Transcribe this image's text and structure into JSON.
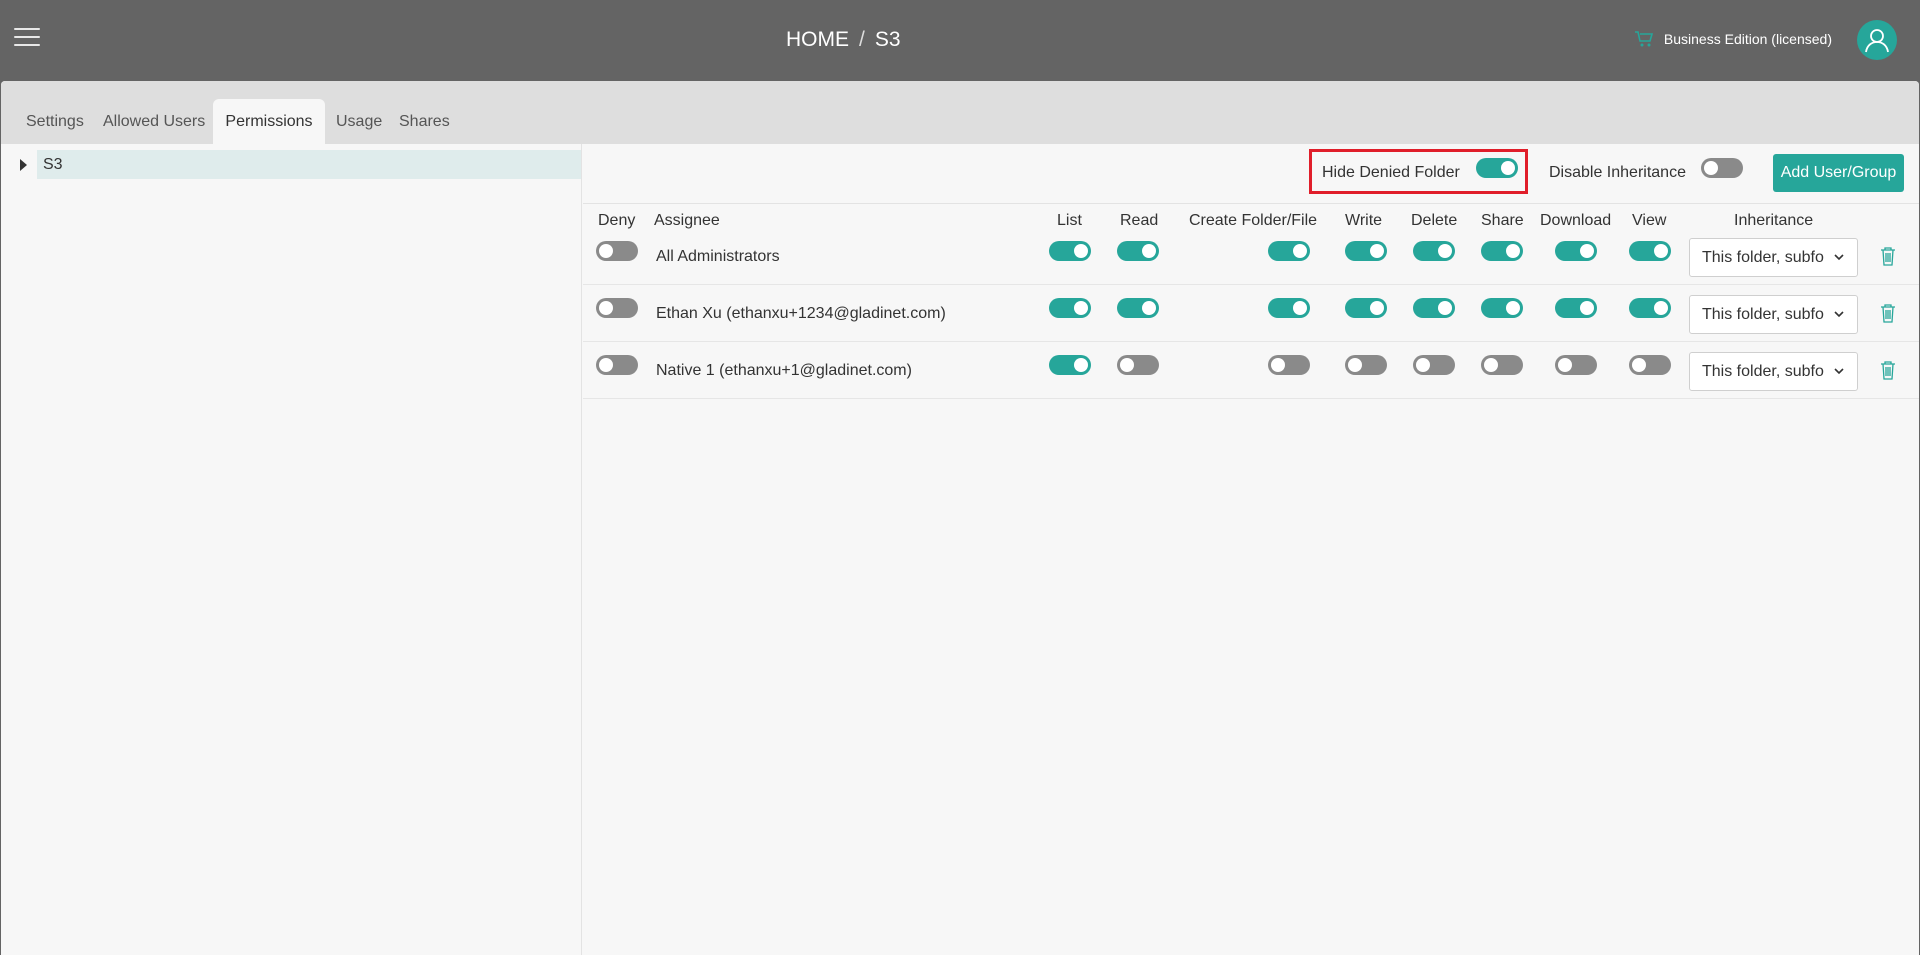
{
  "header": {
    "breadcrumb": [
      "HOME",
      "S3"
    ],
    "breadcrumb_sep": "/",
    "edition_label": "Business Edition (licensed)"
  },
  "tabs": [
    {
      "label": "Settings"
    },
    {
      "label": "Allowed Users"
    },
    {
      "label": "Permissions"
    },
    {
      "label": "Usage"
    },
    {
      "label": "Shares"
    }
  ],
  "active_tab": "Permissions",
  "tree": {
    "root_label": "S3"
  },
  "toolbar": {
    "hide_denied_label": "Hide Denied Folder",
    "hide_denied_on": true,
    "disable_inheritance_label": "Disable Inheritance",
    "disable_inheritance_on": false,
    "add_button_label": "Add User/Group"
  },
  "columns": [
    "Deny",
    "Assignee",
    "List",
    "Read",
    "Create Folder/File",
    "Write",
    "Delete",
    "Share",
    "Download",
    "View",
    "Inheritance"
  ],
  "rows": [
    {
      "assignee": "All Administrators",
      "deny": false,
      "list": true,
      "read": true,
      "create": true,
      "write": true,
      "delete": true,
      "share": true,
      "download": true,
      "view": true,
      "inheritance": "This folder, subfolders and files"
    },
    {
      "assignee": "Ethan Xu (ethanxu+1234@gladinet.com)",
      "deny": false,
      "list": true,
      "read": true,
      "create": true,
      "write": true,
      "delete": true,
      "share": true,
      "download": true,
      "view": true,
      "inheritance": "This folder, subfolders and files"
    },
    {
      "assignee": "Native 1 (ethanxu+1@gladinet.com)",
      "deny": false,
      "list": true,
      "read": false,
      "create": false,
      "write": false,
      "delete": false,
      "share": false,
      "download": false,
      "view": false,
      "inheritance": "This folder, subfolders and files"
    }
  ],
  "colors": {
    "accent": "#26a69a",
    "off": "#8a8a8a",
    "highlight": "#e01e2a",
    "topbar": "#646464"
  }
}
